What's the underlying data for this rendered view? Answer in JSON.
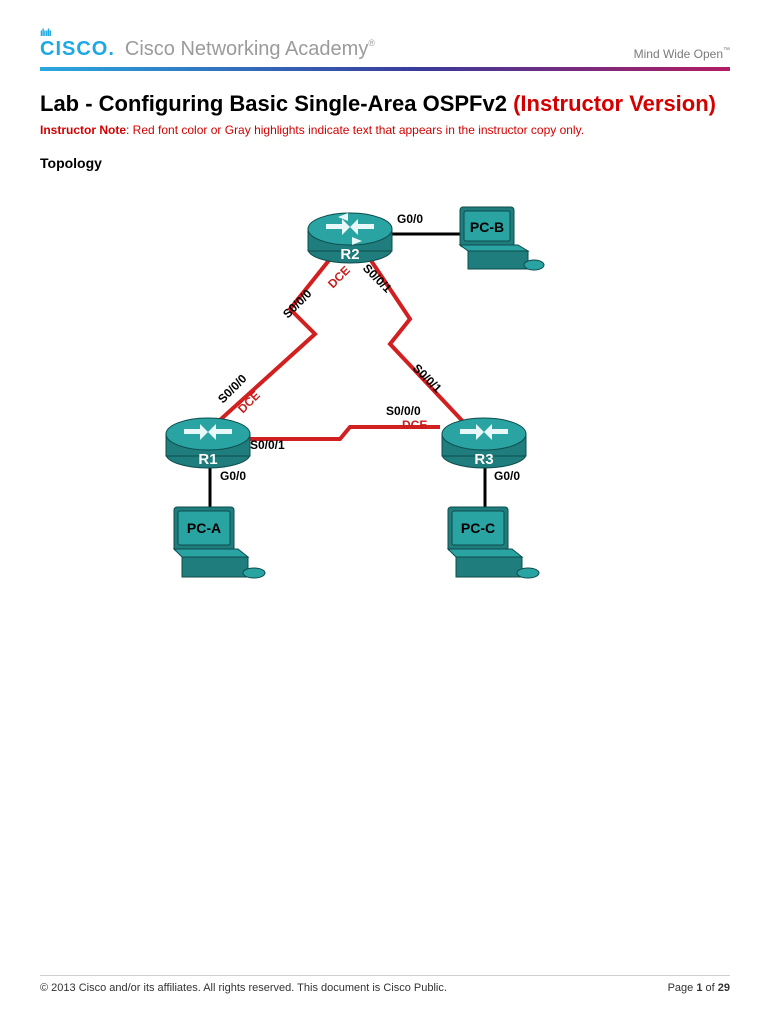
{
  "brand": {
    "logo_bars": "ılıılı",
    "logo_text": "CISCO",
    "academy": "Cisco Networking Academy",
    "tagline": "Mind Wide Open"
  },
  "title": {
    "black": "Lab - Configuring Basic Single-Area OSPFv2 ",
    "red": "(Instructor Version)"
  },
  "note": {
    "lead": "Instructor Note",
    "body": ": Red font color or Gray highlights indicate text that appears in the instructor copy only."
  },
  "section": {
    "topology": "Topology"
  },
  "topology": {
    "routers": {
      "r1": "R1",
      "r2": "R2",
      "r3": "R3"
    },
    "pcs": {
      "a": "PC-A",
      "b": "PC-B",
      "c": "PC-C"
    },
    "intf": {
      "g00": "G0/0",
      "s000": "S0/0/0",
      "s001": "S0/0/1",
      "dce": "DCE"
    }
  },
  "footer": {
    "copyright": "© 2013 Cisco and/or its affiliates. All rights reserved. This document is Cisco Public.",
    "page_prefix": "Page ",
    "page_num": "1",
    "page_of": " of ",
    "page_total": "29"
  }
}
